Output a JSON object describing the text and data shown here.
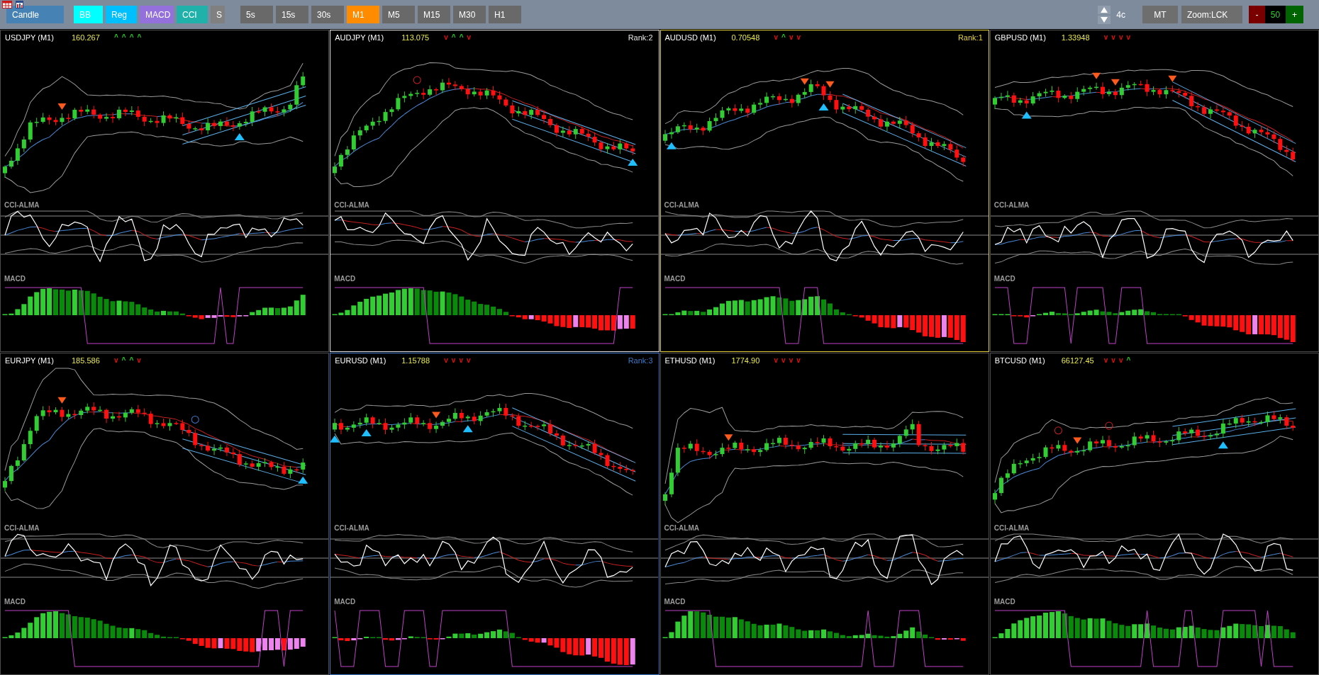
{
  "toolbar": {
    "chart_type": "Candle",
    "indicators": [
      {
        "label": "BB",
        "on": true,
        "color": "#00ffff"
      },
      {
        "label": "Reg",
        "on": true,
        "color": "#00bfff"
      },
      {
        "label": "MACD",
        "on": true,
        "color": "#9370db"
      },
      {
        "label": "CCI",
        "on": true,
        "color": "#20b2aa"
      },
      {
        "label": "S",
        "on": false
      }
    ],
    "timeframes": [
      {
        "label": "5s",
        "selected": false
      },
      {
        "label": "15s",
        "selected": false
      },
      {
        "label": "30s",
        "selected": false
      },
      {
        "label": "M1",
        "selected": true
      },
      {
        "label": "M5",
        "selected": false
      },
      {
        "label": "M15",
        "selected": false
      },
      {
        "label": "M30",
        "selected": false
      },
      {
        "label": "H1",
        "selected": false
      }
    ],
    "columns": "4c",
    "mode": "MT",
    "zoom": "Zoom:LCK",
    "counter": {
      "decrease": "-",
      "value": "50",
      "increase": "+"
    }
  },
  "panels": [
    {
      "symbol": "USDJPY (M1)",
      "price": "160.267",
      "signals": [
        {
          "text": "^",
          "kind": "up"
        },
        {
          "text": "^",
          "kind": "up"
        },
        {
          "text": "^",
          "kind": "up"
        },
        {
          "text": "^",
          "kind": "up"
        }
      ],
      "cci_label": "CCI-ALMA",
      "macd_label": "MACD"
    },
    {
      "symbol": "AUDJPY (M1)",
      "price": "113.075",
      "signals": [
        {
          "text": "v",
          "kind": "down"
        },
        {
          "text": "^",
          "kind": "up"
        },
        {
          "text": "^",
          "kind": "up"
        },
        {
          "text": "v",
          "kind": "down"
        }
      ],
      "rank": {
        "text": "Rank:2",
        "color": "#e6e6e6"
      },
      "cci_label": "CCI-ALMA",
      "macd_label": "MACD"
    },
    {
      "symbol": "AUDUSD (M1)",
      "price": "0.70548",
      "signals": [
        {
          "text": "v",
          "kind": "down"
        },
        {
          "text": "^",
          "kind": "up"
        },
        {
          "text": "v",
          "kind": "down"
        },
        {
          "text": "v",
          "kind": "down"
        }
      ],
      "rank": {
        "text": "Rank:1",
        "color": "#e8d23c"
      },
      "cci_label": "CCI-ALMA",
      "macd_label": "MACD"
    },
    {
      "symbol": "GBPUSD (M1)",
      "price": "1.33948",
      "signals": [
        {
          "text": "v",
          "kind": "down"
        },
        {
          "text": "v",
          "kind": "down"
        },
        {
          "text": "v",
          "kind": "down"
        },
        {
          "text": "v",
          "kind": "down"
        }
      ],
      "cci_label": "CCI-ALMA",
      "macd_label": "MACD"
    },
    {
      "symbol": "EURJPY (M1)",
      "price": "185.586",
      "signals": [
        {
          "text": "v",
          "kind": "down"
        },
        {
          "text": "^",
          "kind": "up"
        },
        {
          "text": "^",
          "kind": "up"
        },
        {
          "text": "v",
          "kind": "down"
        }
      ],
      "cci_label": "CCI-ALMA",
      "macd_label": "MACD"
    },
    {
      "symbol": "EURUSD (M1)",
      "price": "1.15788",
      "signals": [
        {
          "text": "v",
          "kind": "down"
        },
        {
          "text": "v",
          "kind": "down"
        },
        {
          "text": "v",
          "kind": "down"
        },
        {
          "text": "v",
          "kind": "down"
        }
      ],
      "rank": {
        "text": "Rank:3",
        "color": "#3c78c8"
      },
      "cci_label": "CCI-ALMA",
      "macd_label": "MACD"
    },
    {
      "symbol": "ETHUSD (M1)",
      "price": "1774.90",
      "signals": [
        {
          "text": "v",
          "kind": "down"
        },
        {
          "text": "v",
          "kind": "down"
        },
        {
          "text": "v",
          "kind": "down"
        },
        {
          "text": "v",
          "kind": "down"
        }
      ],
      "cci_label": "CCI-ALMA",
      "macd_label": "MACD"
    },
    {
      "symbol": "BTCUSD (M1)",
      "price": "66127.45",
      "signals": [
        {
          "text": "v",
          "kind": "down"
        },
        {
          "text": "v",
          "kind": "down"
        },
        {
          "text": "v",
          "kind": "down"
        },
        {
          "text": "^",
          "kind": "up"
        }
      ],
      "cci_label": "CCI-ALMA",
      "macd_label": "MACD"
    }
  ]
}
